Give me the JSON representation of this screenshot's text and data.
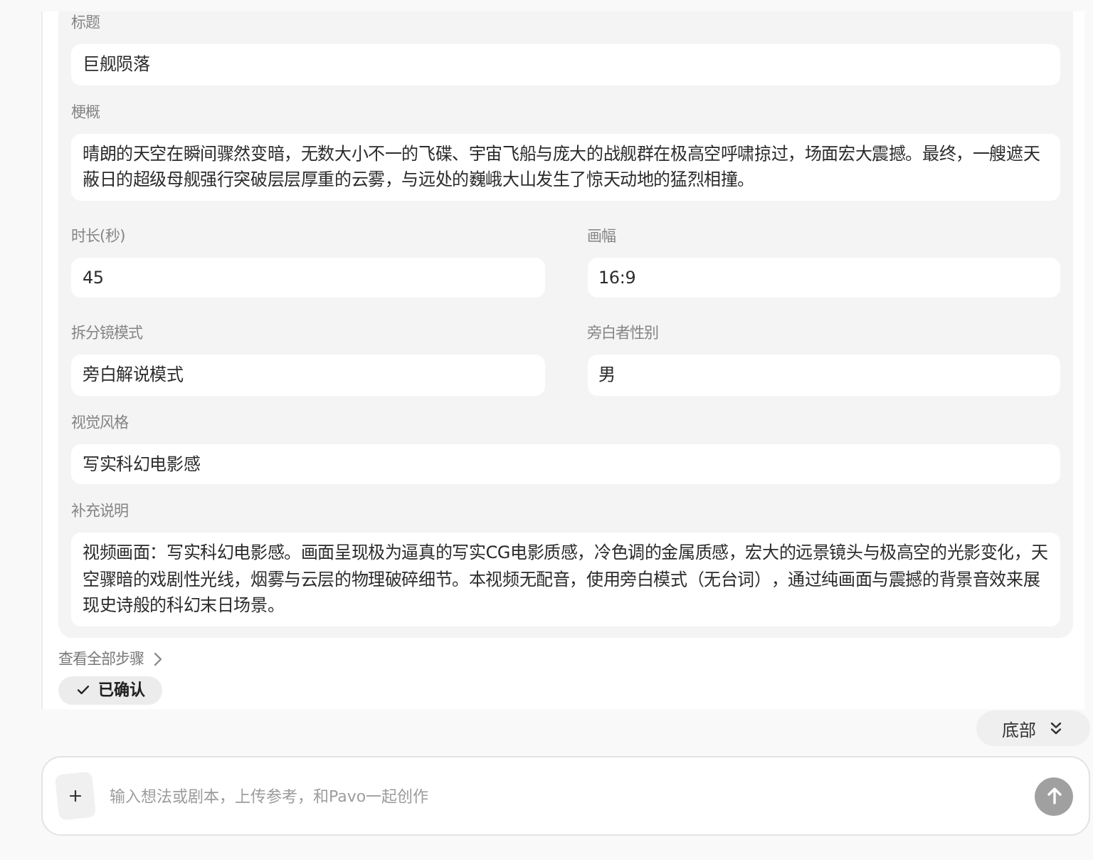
{
  "form": {
    "rows": [
      [
        {
          "label": "标题",
          "value": "巨舰陨落"
        }
      ],
      [
        {
          "label": "梗概",
          "value": "晴朗的天空在瞬间骤然变暗，无数大小不一的飞碟、宇宙飞船与庞大的战舰群在极高空呼啸掠过，场面宏大震撼。最终，一艘遮天蔽日的超级母舰强行突破层层厚重的云雾，与远处的巍峨大山发生了惊天动地的猛烈相撞。"
        }
      ],
      [
        {
          "label": "时长(秒)",
          "value": "45"
        },
        {
          "label": "画幅",
          "value": "16:9"
        }
      ],
      [
        {
          "label": "拆分镜模式",
          "value": "旁白解说模式"
        },
        {
          "label": "旁白者性别",
          "value": "男"
        }
      ],
      [
        {
          "label": "视觉风格",
          "value": "写实科幻电影感"
        }
      ],
      [
        {
          "label": "补充说明",
          "value": "视频画面：写实科幻电影感。画面呈现极为逼真的写实CG电影质感，冷色调的金属质感，宏大的远景镜头与极高空的光影变化，天空骤暗的戏剧性光线，烟雾与云层的物理破碎细节。本视频无配音，使用旁白模式（无台词），通过纯画面与震撼的背景音效来展现史诗般的科幻末日场景。"
        }
      ]
    ]
  },
  "steps_link": {
    "label": "查看全部步骤"
  },
  "status_badge": {
    "label": "已确认"
  },
  "scroll_bottom_button": {
    "label": "底部"
  },
  "composer": {
    "placeholder": "输入想法或剧本，上传参考，和Pavo一起创作",
    "send_button": {
      "disabled": true
    }
  }
}
